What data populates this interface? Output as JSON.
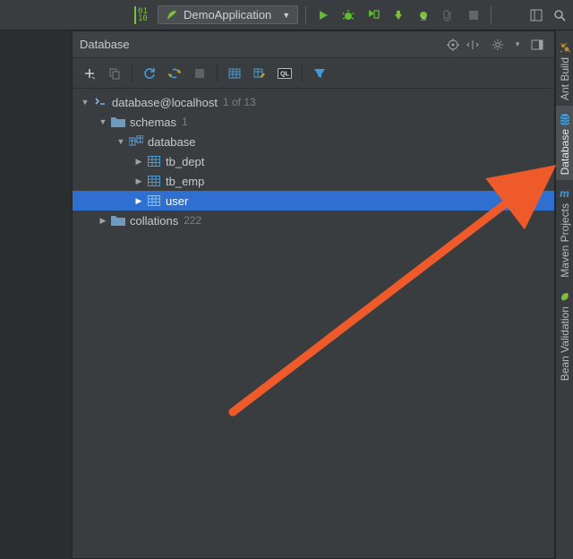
{
  "toolbar": {
    "binary": "01\n10",
    "config_name": "DemoApplication",
    "swoosh": "✓",
    "dropdown": "▼"
  },
  "panel": {
    "title": "Database"
  },
  "tree": {
    "root": {
      "label": "database@localhost",
      "meta": "1 of 13"
    },
    "schemas": {
      "label": "schemas",
      "meta": "1",
      "db": {
        "label": "database",
        "tables": [
          {
            "label": "tb_dept"
          },
          {
            "label": "tb_emp"
          },
          {
            "label": "user"
          }
        ]
      }
    },
    "collations": {
      "label": "collations",
      "meta": "222"
    }
  },
  "rail": {
    "tabs": [
      {
        "label": "Ant Build"
      },
      {
        "label": "Database"
      },
      {
        "label": "Maven Projects"
      },
      {
        "label": "Bean Validation"
      }
    ]
  }
}
